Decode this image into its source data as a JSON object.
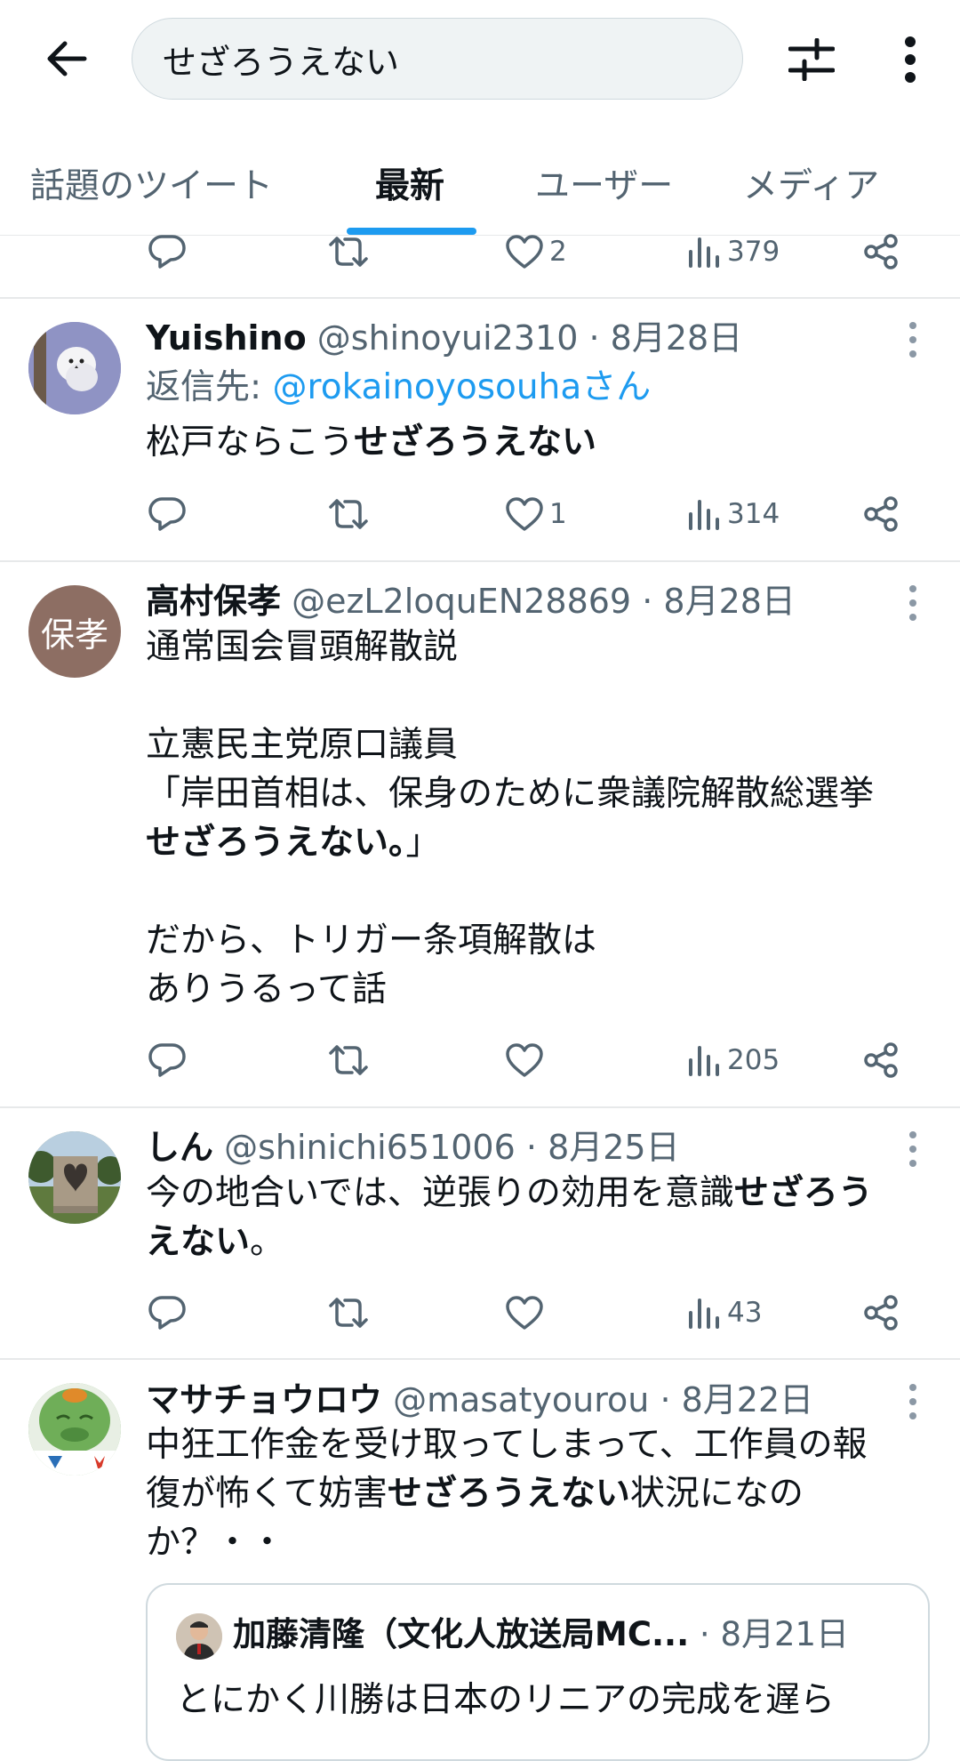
{
  "header": {
    "search_value": "せざろうえない",
    "icons": {
      "back": "arrow-left-icon",
      "filter": "sliders-icon",
      "more": "more-vertical-icon"
    }
  },
  "tabs": [
    {
      "label": "話題のツイート",
      "active": false
    },
    {
      "label": "最新",
      "active": true
    },
    {
      "label": "ユーザー",
      "active": false
    },
    {
      "label": "メディア",
      "active": false
    }
  ],
  "colors": {
    "accent": "#1d9bf0",
    "muted": "#536471",
    "text": "#0f1419",
    "divider": "#e7e9ea"
  },
  "previous_tweet_actions": {
    "likes": "2",
    "views": "379"
  },
  "tweets": [
    {
      "name": "Yuishino",
      "handle": "@shinoyui2310",
      "date": "8月28日",
      "reply_prefix": "返信先: ",
      "reply_mention": "@rokainoyosouhaさん",
      "text_before": "松戸ならこう",
      "text_highlight": "せざろうえない",
      "likes": "1",
      "views": "314"
    },
    {
      "name": "高村保孝",
      "handle": "@ezL2loquEN28869",
      "date": "8月28日",
      "avatar_text": "保孝",
      "line1": "通常国会冒頭解散説",
      "line2": "立憲民主党原口議員",
      "line3": "「岸田首相は、保身のために衆議院解散総選挙",
      "line4_highlight": "せざろうえない。",
      "line4_after": "」",
      "line5": "だから、トリガー条項解散は",
      "line6": "ありうるって話",
      "likes": "",
      "views": "205"
    },
    {
      "name": "しん",
      "handle": "@shinichi651006",
      "date": "8月25日",
      "line1_before": "今の地合いでは、逆張りの効用を意識",
      "line1_highlight": "せざろう",
      "line2_highlight": "えない",
      "line2_after": "。",
      "likes": "",
      "views": "43"
    },
    {
      "name": "マサチョウロウ",
      "handle": "@masatyourou",
      "date": "8月22日",
      "line1": "中狂工作金を受け取ってしまって、工作員の報",
      "line2_before": "復が怖くて妨害",
      "line2_highlight": "せざろうえない",
      "line2_after": "状況になの",
      "line3": "か？・・",
      "quote": {
        "name": "加藤清隆（文化人放送局MC...",
        "date": "8月21日",
        "text": "とにかく川勝は日本のリニアの完成を遅ら"
      }
    }
  ]
}
